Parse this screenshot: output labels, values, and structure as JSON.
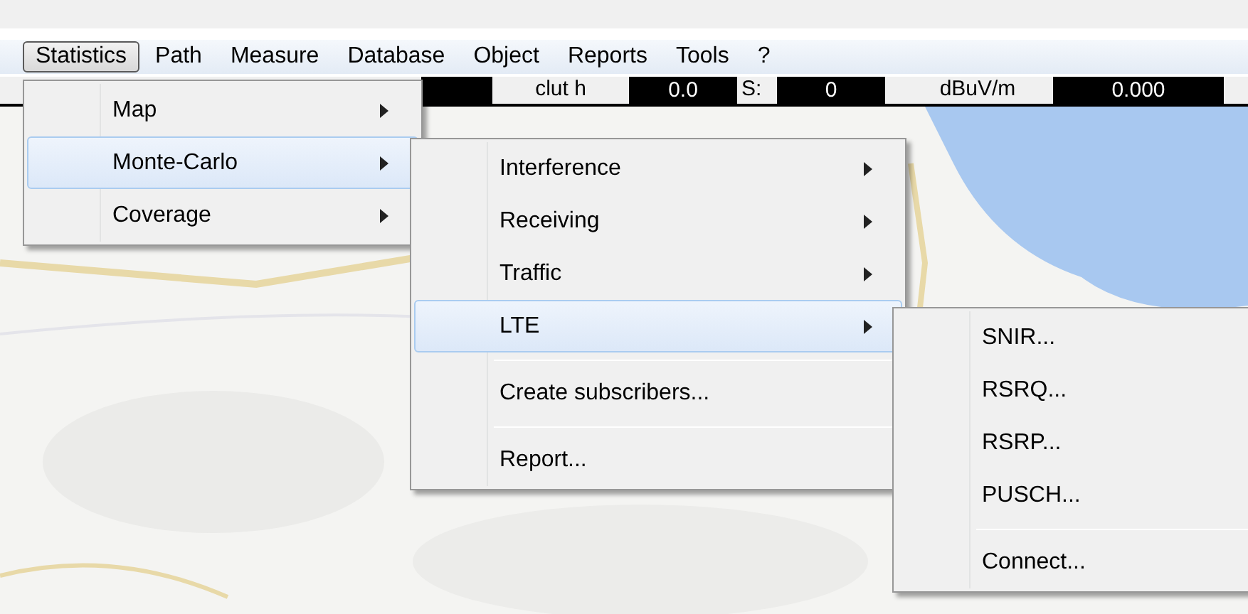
{
  "menubar": [
    {
      "label": "Statistics",
      "selected": true
    },
    {
      "label": "Path",
      "selected": false
    },
    {
      "label": "Measure",
      "selected": false
    },
    {
      "label": "Database",
      "selected": false
    },
    {
      "label": "Object",
      "selected": false
    },
    {
      "label": "Reports",
      "selected": false
    },
    {
      "label": "Tools",
      "selected": false
    },
    {
      "label": "?",
      "selected": false
    }
  ],
  "status_fields": [
    {
      "kind": "value"
    },
    {
      "kind": "label",
      "text": "clut h"
    },
    {
      "kind": "value",
      "text": "0.0"
    },
    {
      "kind": "label",
      "text": "S:"
    },
    {
      "kind": "value",
      "text": "0"
    },
    {
      "kind": "label",
      "text": "dBuV/m"
    },
    {
      "kind": "value",
      "text": "0.000"
    }
  ],
  "menus": [
    {
      "items": [
        {
          "kind": "item",
          "label": "Map",
          "submenu": true,
          "selected": false
        },
        {
          "kind": "item",
          "label": "Monte-Carlo",
          "submenu": true,
          "selected": true
        },
        {
          "kind": "item",
          "label": "Coverage",
          "submenu": true,
          "selected": false
        }
      ]
    },
    {
      "items": [
        {
          "kind": "item",
          "label": "Interference",
          "submenu": true,
          "selected": false
        },
        {
          "kind": "item",
          "label": "Receiving",
          "submenu": true,
          "selected": false
        },
        {
          "kind": "item",
          "label": "Traffic",
          "submenu": true,
          "selected": false
        },
        {
          "kind": "item",
          "label": "LTE",
          "submenu": true,
          "selected": true
        },
        {
          "kind": "separator"
        },
        {
          "kind": "item",
          "label": "Create subscribers...",
          "submenu": false,
          "selected": false
        },
        {
          "kind": "separator"
        },
        {
          "kind": "item",
          "label": "Report...",
          "submenu": false,
          "selected": false
        }
      ]
    },
    {
      "items": [
        {
          "kind": "item",
          "label": "SNIR...",
          "submenu": false,
          "selected": false
        },
        {
          "kind": "item",
          "label": "RSRQ...",
          "submenu": false,
          "selected": false
        },
        {
          "kind": "item",
          "label": "RSRP...",
          "submenu": false,
          "selected": false
        },
        {
          "kind": "item",
          "label": "PUSCH...",
          "submenu": false,
          "selected": false
        },
        {
          "kind": "separator"
        },
        {
          "kind": "item",
          "label": "Connect...",
          "submenu": false,
          "selected": false
        }
      ]
    }
  ]
}
